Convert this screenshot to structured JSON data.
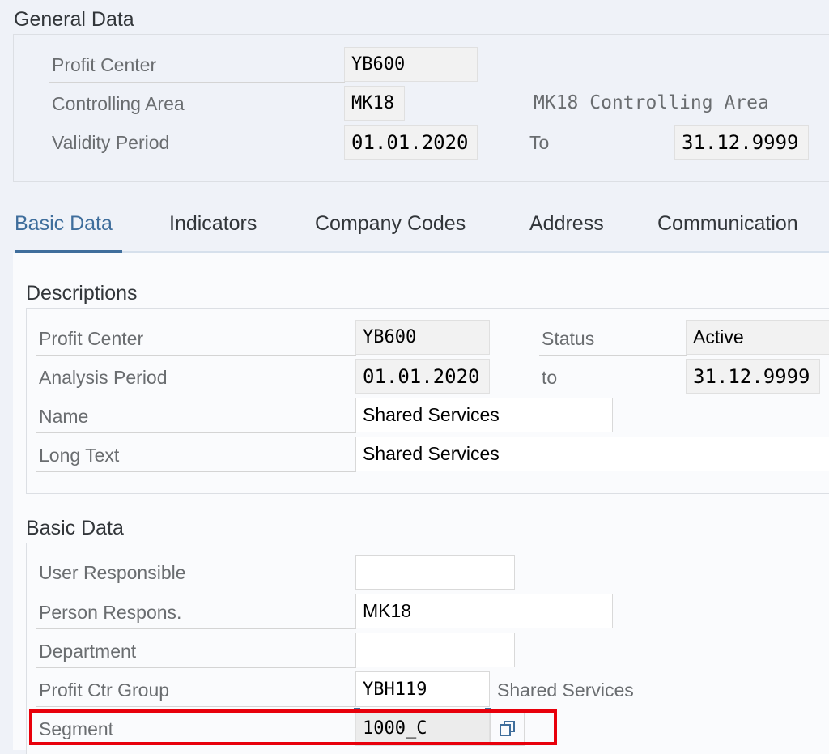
{
  "general_data": {
    "title": "General Data",
    "profit_center": {
      "label": "Profit Center",
      "value": "YB600"
    },
    "controlling_area": {
      "label": "Controlling Area",
      "value": "MK18",
      "description": "MK18 Controlling Area"
    },
    "validity_period": {
      "label": "Validity Period",
      "from": "01.01.2020",
      "to_label": "To",
      "to": "31.12.9999"
    }
  },
  "tabs": [
    {
      "label": "Basic Data",
      "active": true
    },
    {
      "label": "Indicators",
      "active": false
    },
    {
      "label": "Company Codes",
      "active": false
    },
    {
      "label": "Address",
      "active": false
    },
    {
      "label": "Communication",
      "active": false
    }
  ],
  "descriptions": {
    "title": "Descriptions",
    "profit_center": {
      "label": "Profit Center",
      "value": "YB600"
    },
    "status": {
      "label": "Status",
      "value": "Active"
    },
    "analysis_period": {
      "label": "Analysis Period",
      "from": "01.01.2020",
      "to_label": "to",
      "to": "31.12.9999"
    },
    "name": {
      "label": "Name",
      "value": "Shared Services"
    },
    "long_text": {
      "label": "Long Text",
      "value": "Shared Services"
    }
  },
  "basic_data": {
    "title": "Basic Data",
    "user_responsible": {
      "label": "User Responsible",
      "value": ""
    },
    "person_responsible": {
      "label": "Person Respons.",
      "value": "MK18"
    },
    "department": {
      "label": "Department",
      "value": ""
    },
    "profit_ctr_group": {
      "label": "Profit Ctr Group",
      "value": "YBH119",
      "description": "Shared Services"
    },
    "segment": {
      "label": "Segment",
      "value": "1000_C",
      "value_help_icon": "copy-icon"
    }
  },
  "colors": {
    "accent": "#3f6e9c",
    "highlight": "#e8000b"
  }
}
